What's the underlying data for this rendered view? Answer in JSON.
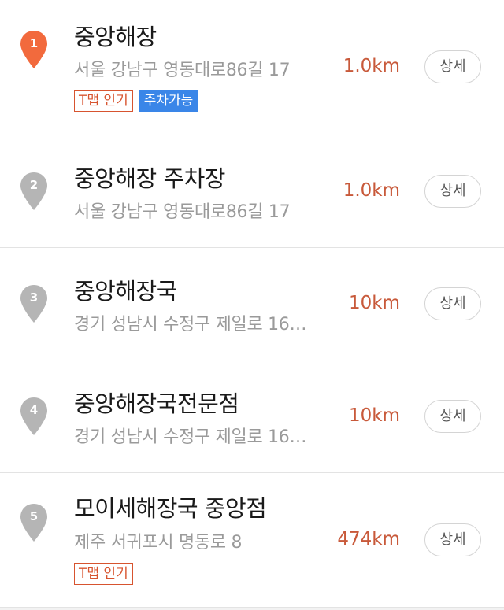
{
  "colors": {
    "active_pin": "#f26a3d",
    "inactive_pin": "#b5b5b5",
    "distance": "#c8593a",
    "tmap_tag": "#d7542f",
    "parking_tag": "#3a86e8"
  },
  "results": [
    {
      "rank": "1",
      "name": "중앙해장",
      "address": "서울 강남구 영동대로86길 17",
      "distance": "1.0km",
      "detail_label": "상세",
      "tags": {
        "tmap": "T맵 인기",
        "parking": "주차가능"
      },
      "pin_icon": "map-pin-active"
    },
    {
      "rank": "2",
      "name": "중앙해장 주차장",
      "address": "서울 강남구 영동대로86길 17",
      "distance": "1.0km",
      "detail_label": "상세",
      "pin_icon": "map-pin"
    },
    {
      "rank": "3",
      "name": "중앙해장국",
      "address": "경기 성남시 수정구 제일로 16…",
      "distance": "10km",
      "detail_label": "상세",
      "pin_icon": "map-pin"
    },
    {
      "rank": "4",
      "name": "중앙해장국전문점",
      "address": "경기 성남시 수정구 제일로 16…",
      "distance": "10km",
      "detail_label": "상세",
      "pin_icon": "map-pin"
    },
    {
      "rank": "5",
      "name": "모이세해장국 중앙점",
      "address": "제주 서귀포시 명동로 8",
      "distance": "474km",
      "detail_label": "상세",
      "tags": {
        "tmap": "T맵 인기"
      },
      "pin_icon": "map-pin"
    }
  ]
}
